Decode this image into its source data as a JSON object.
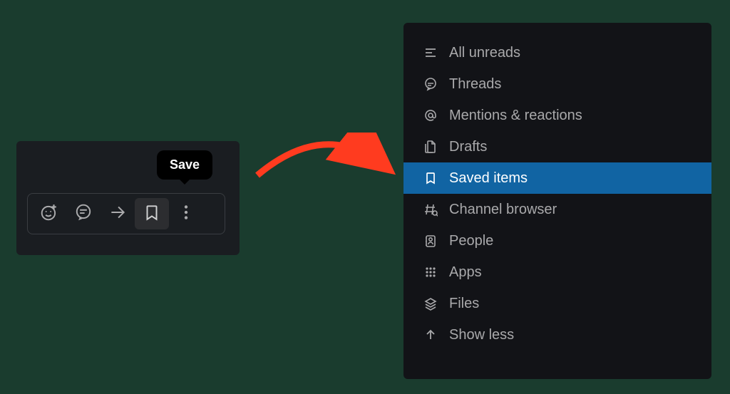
{
  "tooltip": {
    "label": "Save"
  },
  "sidebar": {
    "items": [
      {
        "label": "All unreads"
      },
      {
        "label": "Threads"
      },
      {
        "label": "Mentions & reactions"
      },
      {
        "label": "Drafts"
      },
      {
        "label": "Saved items"
      },
      {
        "label": "Channel browser"
      },
      {
        "label": "People"
      },
      {
        "label": "Apps"
      },
      {
        "label": "Files"
      },
      {
        "label": "Show less"
      }
    ],
    "selected_index": 4
  }
}
